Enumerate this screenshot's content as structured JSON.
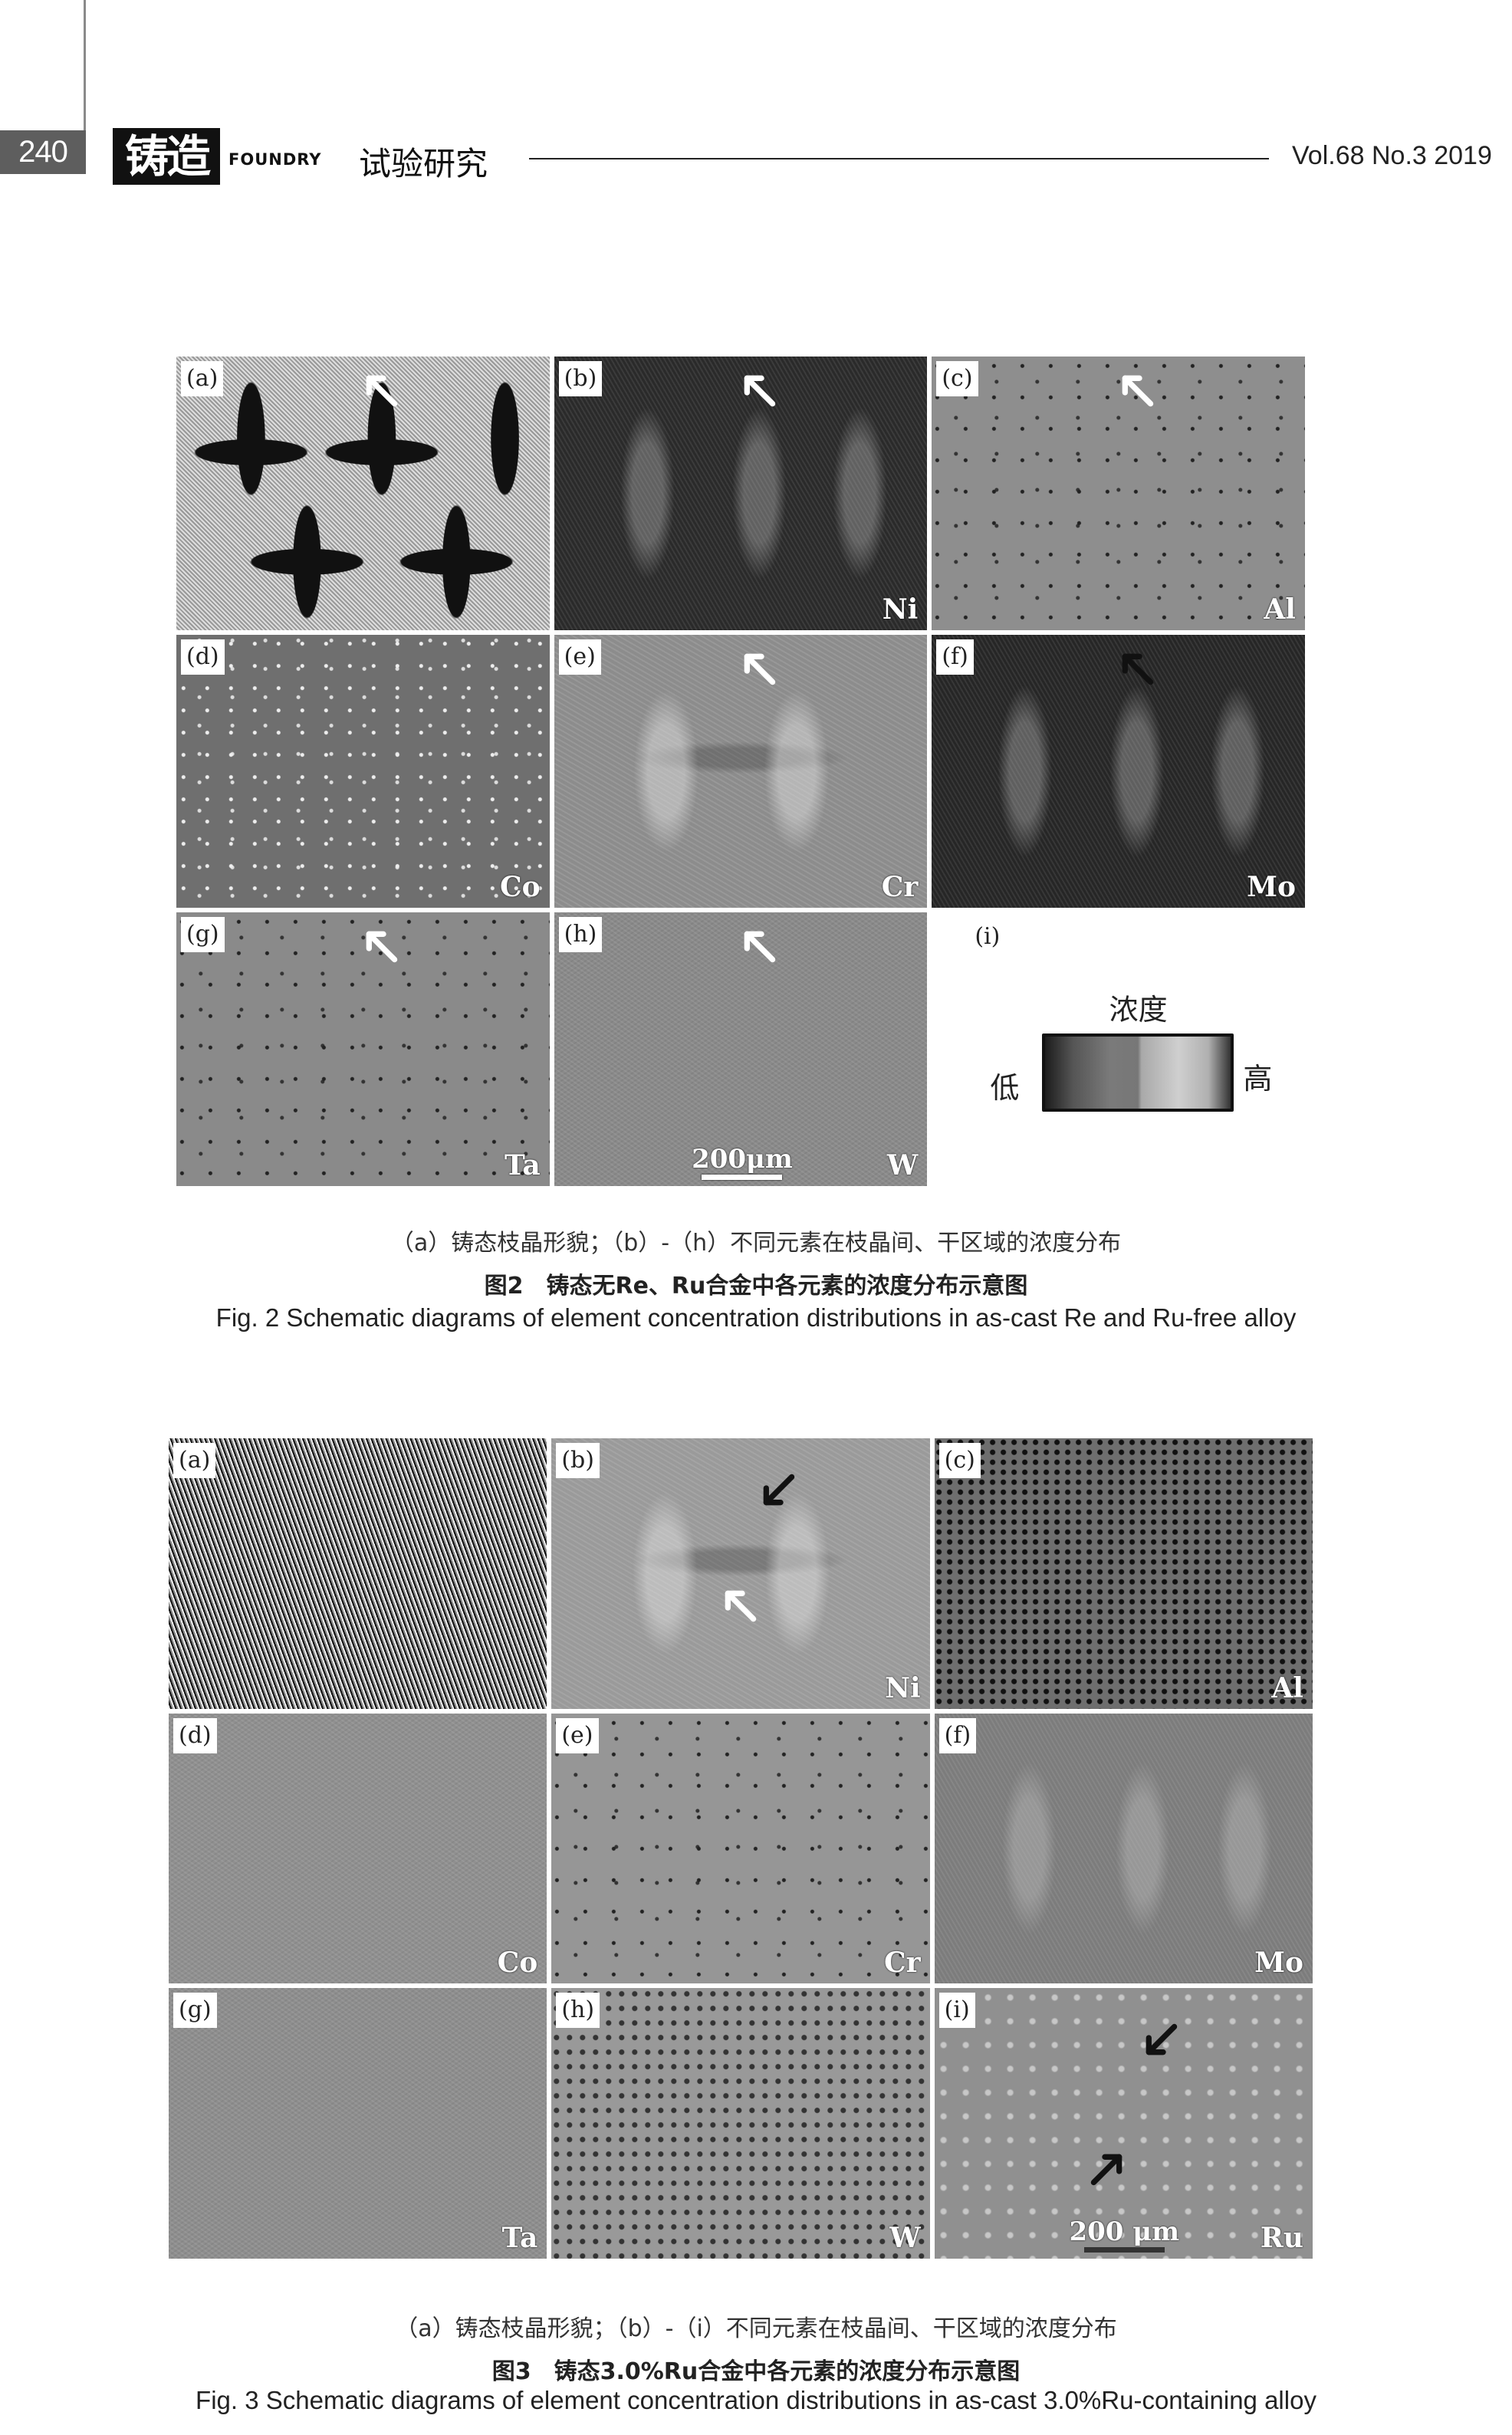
{
  "header": {
    "page_number": "240",
    "journal_logo": "铸造",
    "journal_name_en": "FOUNDRY",
    "section": "试验研究",
    "volume_info": "Vol.68 No.3 2019"
  },
  "figure2": {
    "panels": [
      {
        "tag": "(a)",
        "element": "",
        "background": "#cfcfcf",
        "texture": "light-dendrite",
        "arrow": "white-up-left"
      },
      {
        "tag": "(b)",
        "element": "Ni",
        "background": "#2a2a2a",
        "texture": "dark-dendrite",
        "arrow": "white-up-left"
      },
      {
        "tag": "(c)",
        "element": "Al",
        "background": "#8e8e8e",
        "texture": "gray-spots",
        "arrow": "white-up-left"
      },
      {
        "tag": "(d)",
        "element": "Co",
        "background": "#6f6f6f",
        "texture": "white-specks",
        "arrow": ""
      },
      {
        "tag": "(e)",
        "element": "Cr",
        "background": "#8c8c8c",
        "texture": "gray-dendrite",
        "arrow": "white-up-left"
      },
      {
        "tag": "(f)",
        "element": "Mo",
        "background": "#262626",
        "texture": "dark-dendrite",
        "arrow": "black-up-left"
      },
      {
        "tag": "(g)",
        "element": "Ta",
        "background": "#8a8a8a",
        "texture": "gray-spots",
        "arrow": "white-up-left"
      },
      {
        "tag": "(h)",
        "element": "W",
        "background": "#8a8a8a",
        "texture": "gray-fine",
        "arrow": "white-up-left",
        "scale_bar": "200μm"
      }
    ],
    "legend": {
      "tag": "(i)",
      "title": "浓度",
      "low_label": "低",
      "high_label": "高"
    },
    "caption_sub": "（a）铸态枝晶形貌；（b）-（h）不同元素在枝晶间、干区域的浓度分布",
    "caption_cn": "图2　铸态无Re、Ru合金中各元素的浓度分布示意图",
    "caption_en": "Fig. 2 Schematic diagrams of element concentration distributions in as-cast Re and Ru-free alloy"
  },
  "figure3": {
    "panels": [
      {
        "tag": "(a)",
        "element": "",
        "background": "#555555",
        "texture": "bw-noise",
        "arrow": ""
      },
      {
        "tag": "(b)",
        "element": "Ni",
        "background": "#9a9a9a",
        "texture": "gray-dendrite",
        "arrow": "black-down-left;white-up-left"
      },
      {
        "tag": "(c)",
        "element": "Al",
        "background": "#6e6e6e",
        "texture": "dark-noise",
        "arrow": ""
      },
      {
        "tag": "(d)",
        "element": "Co",
        "background": "#909090",
        "texture": "gray-fine",
        "arrow": ""
      },
      {
        "tag": "(e)",
        "element": "Cr",
        "background": "#969696",
        "texture": "gray-spots",
        "arrow": ""
      },
      {
        "tag": "(f)",
        "element": "Mo",
        "background": "#7c7c7c",
        "texture": "dark-dendrite",
        "arrow": ""
      },
      {
        "tag": "(g)",
        "element": "Ta",
        "background": "#8e8e8e",
        "texture": "gray-fine",
        "arrow": ""
      },
      {
        "tag": "(h)",
        "element": "W",
        "background": "#999999",
        "texture": "dark-spots",
        "arrow": ""
      },
      {
        "tag": "(i)",
        "element": "Ru",
        "background": "#909090",
        "texture": "light-network",
        "arrow": "black-down-left;black-up-right",
        "scale_bar": "200 μm"
      }
    ],
    "caption_sub": "（a）铸态枝晶形貌；（b）-（i）不同元素在枝晶间、干区域的浓度分布",
    "caption_cn": "图3　铸态3.0%Ru合金中各元素的浓度分布示意图",
    "caption_en": "Fig. 3  Schematic diagrams of element concentration distributions in as-cast 3.0%Ru-containing alloy"
  }
}
